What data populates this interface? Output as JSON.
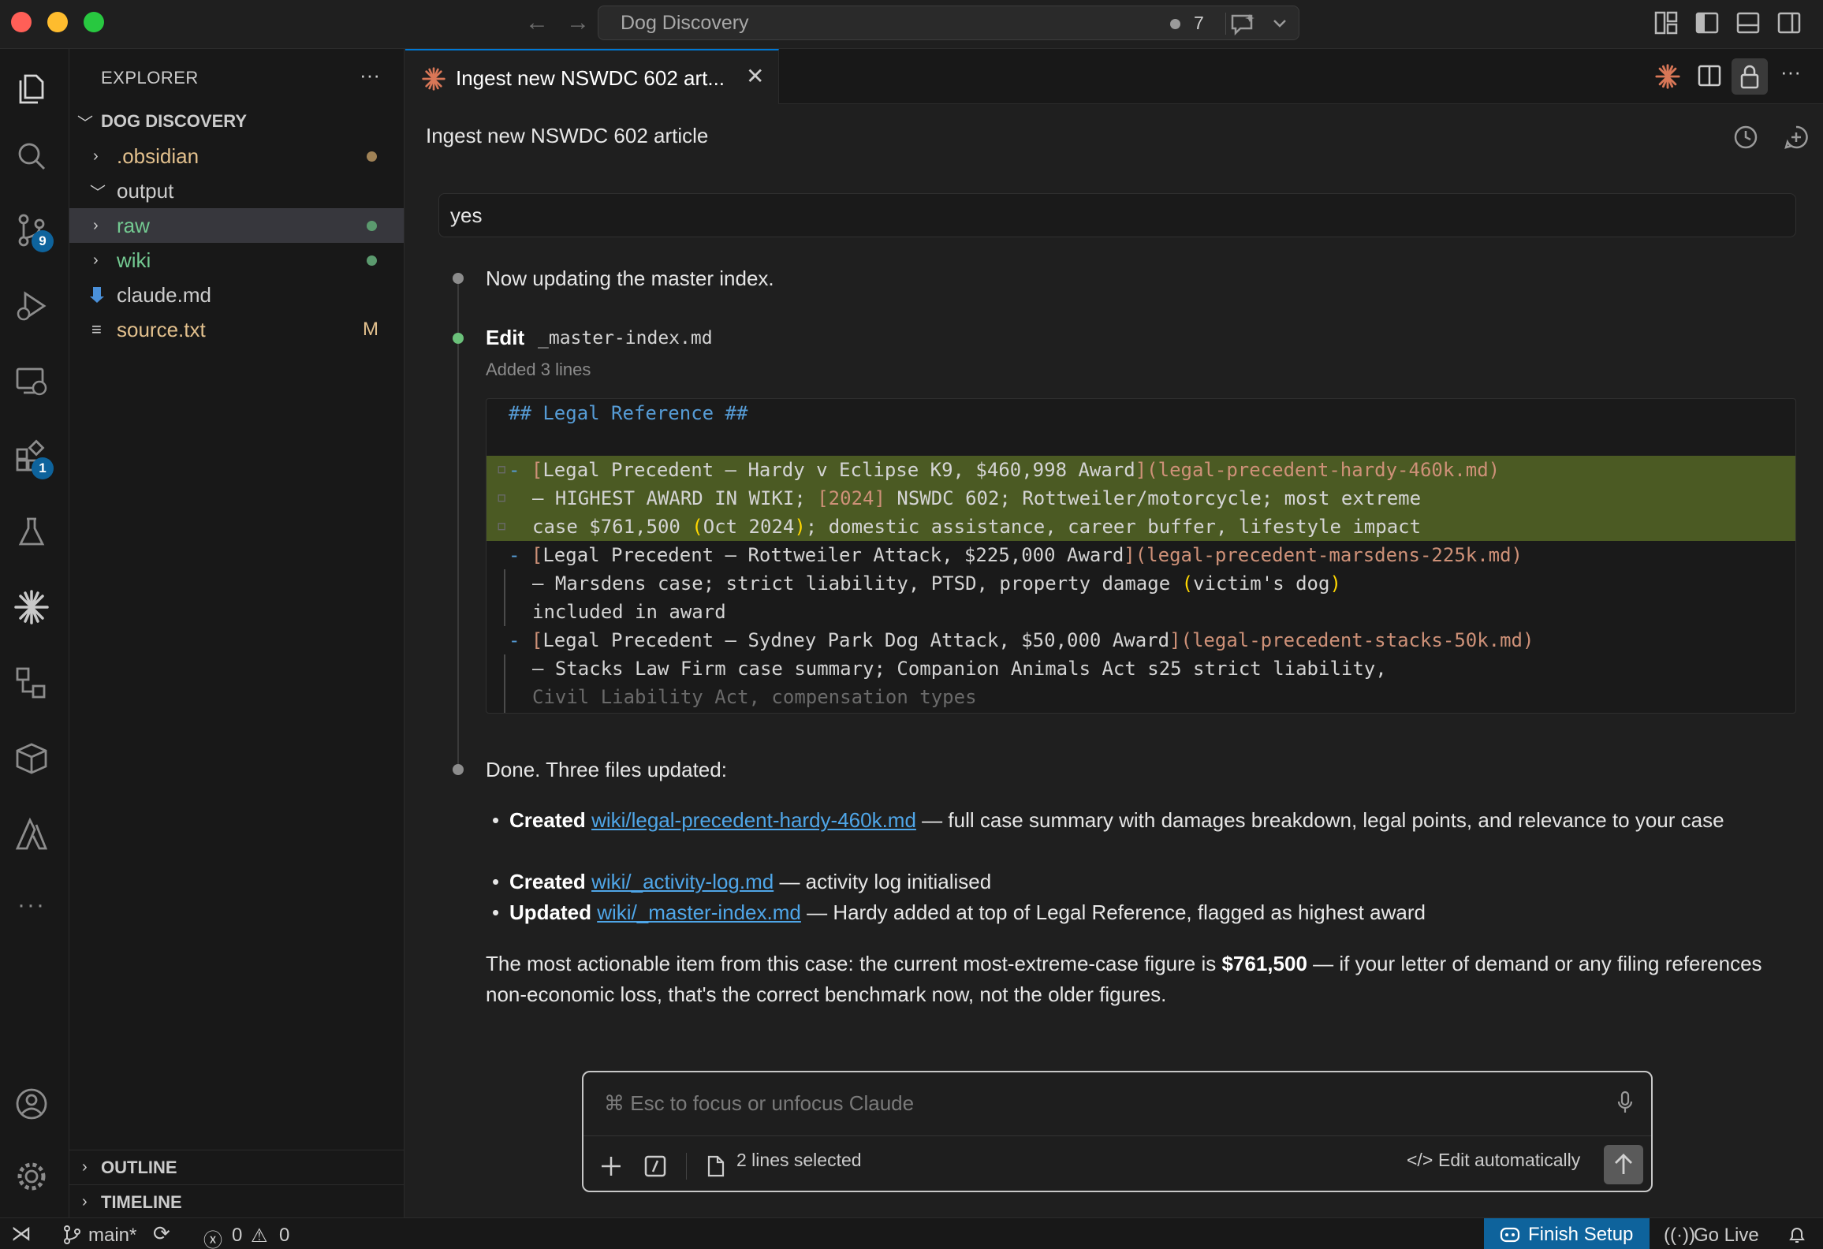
{
  "titlebar": {
    "search_title": "Dog Discovery",
    "notif_count": "7"
  },
  "activity": {
    "scm_badge": "9",
    "ext_badge": "1"
  },
  "explorer": {
    "header": "EXPLORER",
    "root": "DOG DISCOVERY",
    "items": [
      {
        "label": ".obsidian",
        "color": "#e2c08d"
      },
      {
        "label": "output",
        "color": "#cccccc"
      },
      {
        "label": "raw",
        "color": "#73c991"
      },
      {
        "label": "wiki",
        "color": "#73c991"
      },
      {
        "label": "claude.md",
        "color": "#cccccc"
      },
      {
        "label": "source.txt",
        "color": "#e2c08d",
        "mark": "M"
      }
    ],
    "outline": "OUTLINE",
    "timeline": "TIMELINE"
  },
  "tab": {
    "label": "Ingest new NSWDC 602 art..."
  },
  "panel": {
    "title": "Ingest new NSWDC 602 article",
    "user_message": "yes",
    "step1": "Now updating the master index.",
    "edit_label": "Edit",
    "edit_file": "_master-index.md",
    "edit_meta": "Added 3 lines",
    "diff": {
      "l1": "## Legal Reference ##",
      "l2a_dash": "-",
      "l2a_b1": "[",
      "l2a_text": "Legal Precedent — Hardy v Eclipse K9, $460,998 Award",
      "l2a_b2": "]",
      "l2a_link": "(legal-precedent-hardy-460k.md)",
      "l2b_pre": "— HIGHEST AWARD IN WIKI; ",
      "l2b_year": "[2024]",
      "l2b_post": " NSWDC 602; Rottweiler/motorcycle; most extreme",
      "l2c_pre": "case $761,500 ",
      "l2c_p1": "(",
      "l2c_mid": "Oct 2024",
      "l2c_p2": ")",
      "l2c_post": "; domestic assistance, career buffer, lifestyle impact",
      "l3a_dash": "-",
      "l3a_b1": "[",
      "l3a_text": "Legal Precedent — Rottweiler Attack, $225,000 Award",
      "l3a_b2": "]",
      "l3a_link": "(legal-precedent-marsdens-225k.md)",
      "l3b_pre": "— Marsdens case; strict liability, PTSD, property damage ",
      "l3b_p1": "(",
      "l3b_mid": "victim's dog",
      "l3b_p2": ")",
      "l3c": "included in award",
      "l4a_dash": "-",
      "l4a_b1": "[",
      "l4a_text": "Legal Precedent — Sydney Park Dog Attack, $50,000 Award",
      "l4a_b2": "]",
      "l4a_link": "(legal-precedent-stacks-50k.md)",
      "l4b": "— Stacks Law Firm case summary; Companion Animals Act s25 strict liability,",
      "l4c": "Civil Liability Act, compensation types"
    },
    "step3": "Done. Three files updated:",
    "bullets": [
      {
        "verb": "Created",
        "link": "wiki/legal-precedent-hardy-460k.md",
        "rest": " — full case summary with damages breakdown, legal points, and relevance to your case"
      },
      {
        "verb": "Created",
        "link": "wiki/_activity-log.md",
        "rest": " — activity log initialised"
      },
      {
        "verb": "Updated",
        "link": "wiki/_master-index.md",
        "rest": " — Hardy added at top of Legal Reference, flagged as highest award"
      }
    ],
    "final_pre": "The most actionable item from this case: the current most-extreme-case figure is ",
    "final_bold": "$761,500",
    "final_post": " — if your letter of demand or any filing references non-economic loss, that's the correct benchmark now, not the older figures."
  },
  "input": {
    "placeholder": "⌘ Esc to focus or unfocus Claude",
    "selection": "2 lines selected",
    "mode": "Edit automatically"
  },
  "statusbar": {
    "branch": "main*",
    "errors": "0",
    "warnings": "0",
    "finish_setup": "Finish Setup",
    "go_live": "Go Live"
  }
}
